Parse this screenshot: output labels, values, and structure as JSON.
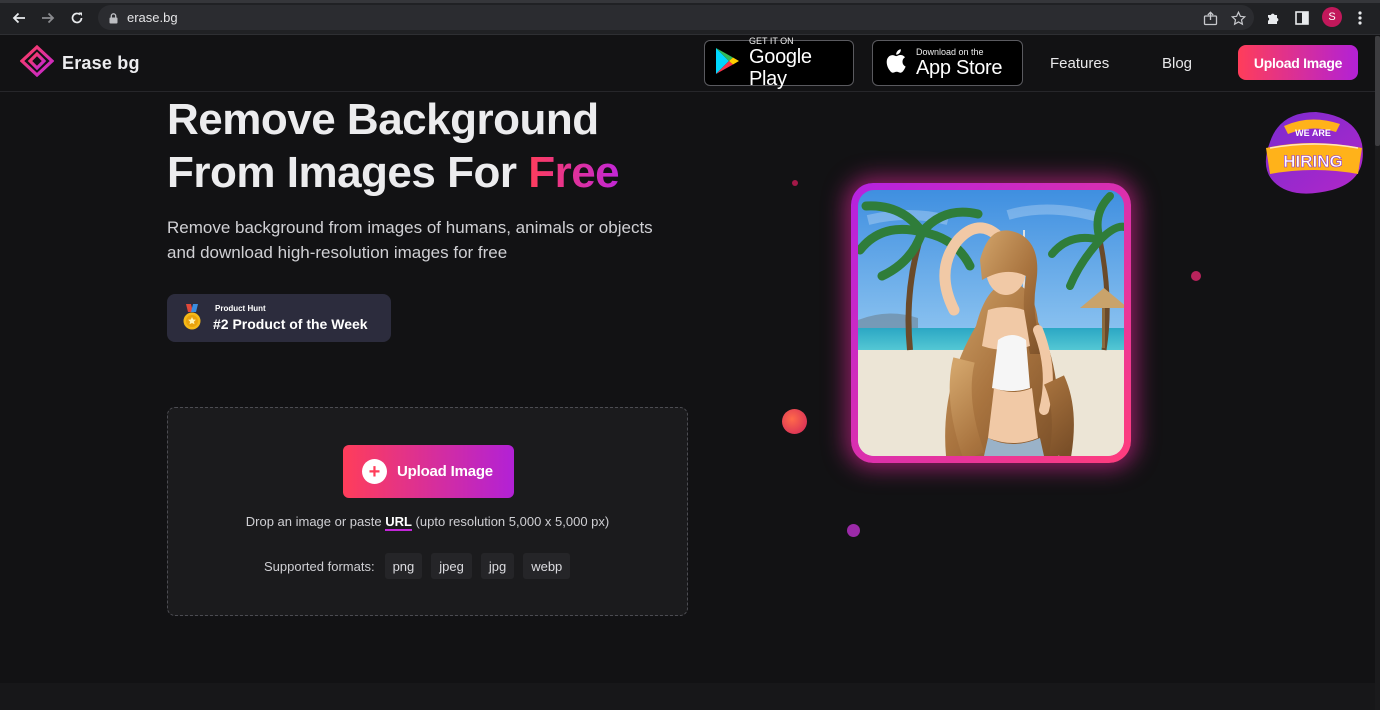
{
  "browser": {
    "url": "erase.bg",
    "profile_initial": "S"
  },
  "header": {
    "logo_text": "Erase bg",
    "google_play": {
      "small": "GET IT ON",
      "big": "Google Play"
    },
    "app_store": {
      "small": "Download on the",
      "big": "App Store"
    },
    "nav": [
      "Features",
      "Blog"
    ],
    "upload_label": "Upload Image"
  },
  "hero": {
    "title_line1": "Remove Background",
    "title_line2_prefix": "From Images For ",
    "title_highlight": "Free",
    "subtitle_line1": "Remove background from images of humans, animals or objects",
    "subtitle_line2": "and download high-resolution images for free"
  },
  "product_hunt": {
    "label": "Product Hunt",
    "title": "#2 Product of the Week"
  },
  "dropzone": {
    "upload_label": "Upload Image",
    "hint_prefix": "Drop an image or paste ",
    "hint_link": "URL",
    "hint_suffix": " (upto resolution 5,000 x 5,000 px)",
    "formats_label": "Supported formats:",
    "formats": [
      "png",
      "jpeg",
      "jpg",
      "webp"
    ]
  },
  "hiring_badge": {
    "top": "WE ARE",
    "main": "HIRING"
  },
  "colors": {
    "background": "#121214",
    "accent_start": "#ff3d5a",
    "accent_end": "#b221d6"
  },
  "icons": {
    "back": "arrow-left-icon",
    "forward": "arrow-right-icon",
    "reload": "reload-icon",
    "lock": "lock-icon",
    "share": "share-icon",
    "bookmark": "star-icon",
    "extensions": "puzzle-icon",
    "sidepanel": "sidepanel-icon",
    "menu": "kebab-menu-icon",
    "medal": "medal-icon",
    "plus": "plus-icon"
  }
}
